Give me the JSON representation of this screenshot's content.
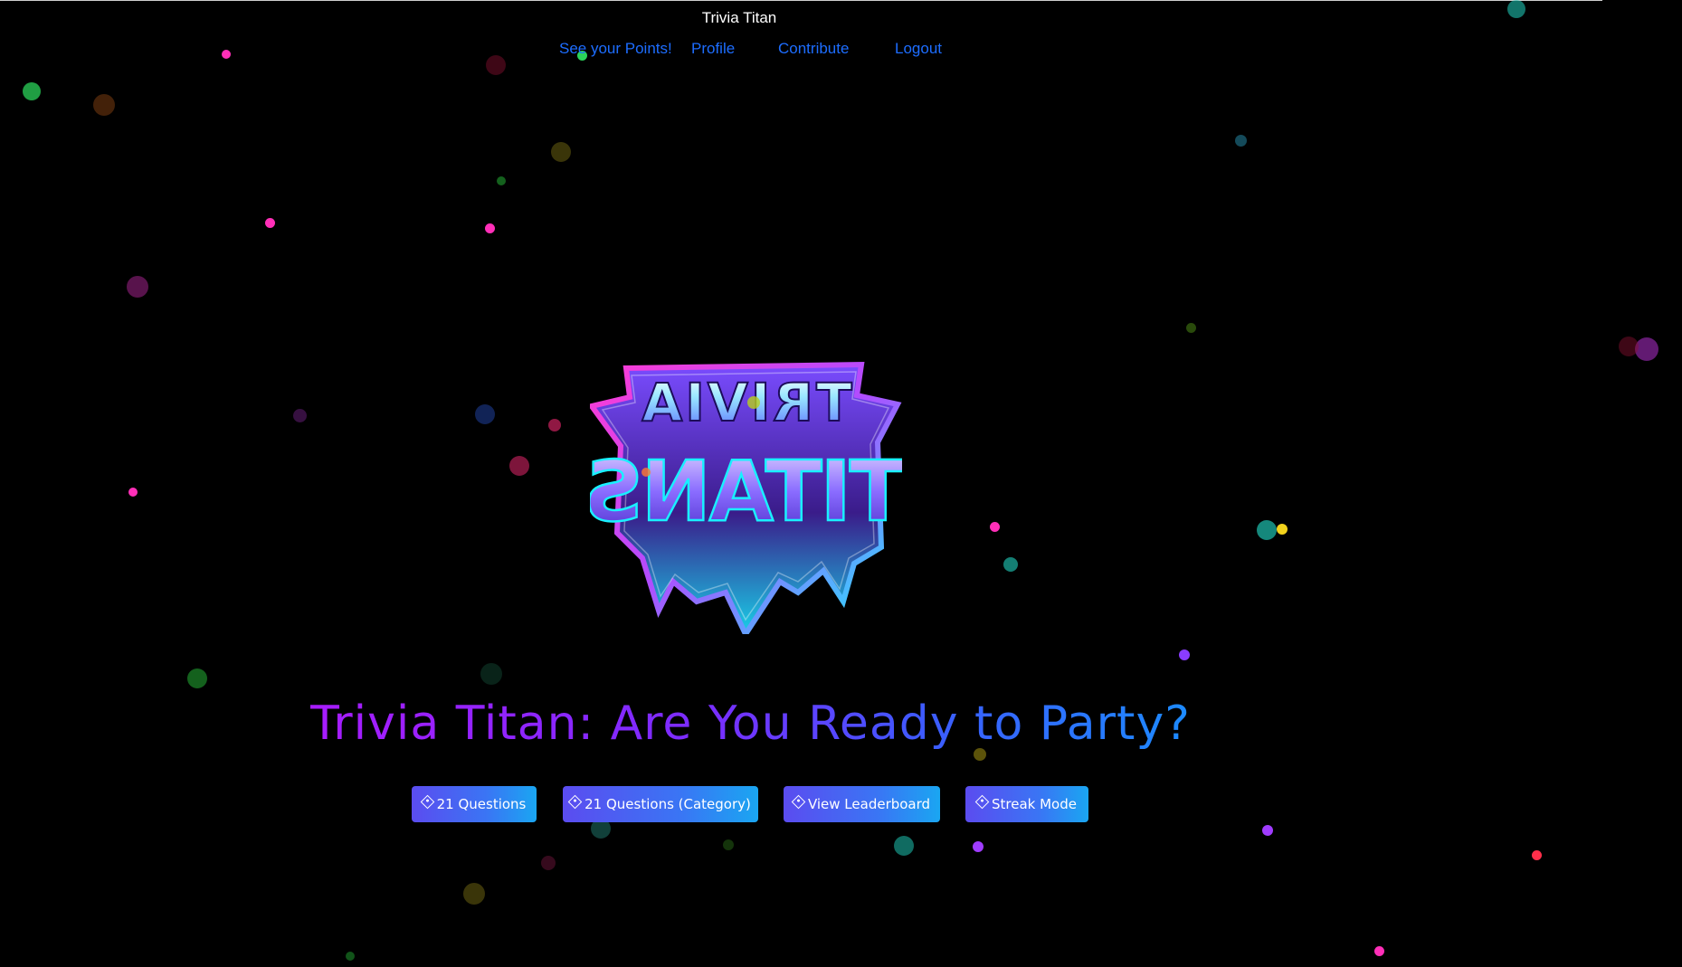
{
  "header": {
    "site_title": "Trivia Titan",
    "nav": [
      {
        "label": "See your Points!"
      },
      {
        "label": "Profile"
      },
      {
        "label": "Contribute"
      },
      {
        "label": "Logout"
      }
    ]
  },
  "logo": {
    "line1": "TRIVIA",
    "line2": "TITANS",
    "colors": {
      "pink": "#ff3bd4",
      "cyan": "#19f0ff",
      "violet": "#6a3cff"
    }
  },
  "headline": "Trivia Titan: Are You Ready to Party?",
  "actions": [
    {
      "label": "21 Questions",
      "icon": "diamond-icon"
    },
    {
      "label": "21 Questions (Category)",
      "icon": "diamond-icon"
    },
    {
      "label": "View Leaderboard",
      "icon": "diamond-icon"
    },
    {
      "label": "Streak Mode",
      "icon": "diamond-icon"
    }
  ],
  "theme": {
    "background": "#000000",
    "nav_link": "#1d6dff",
    "headline_gradient": [
      "#a81cff",
      "#1c8bff"
    ],
    "button_gradient": [
      "#5b4cf0",
      "#1aa6f2"
    ]
  }
}
